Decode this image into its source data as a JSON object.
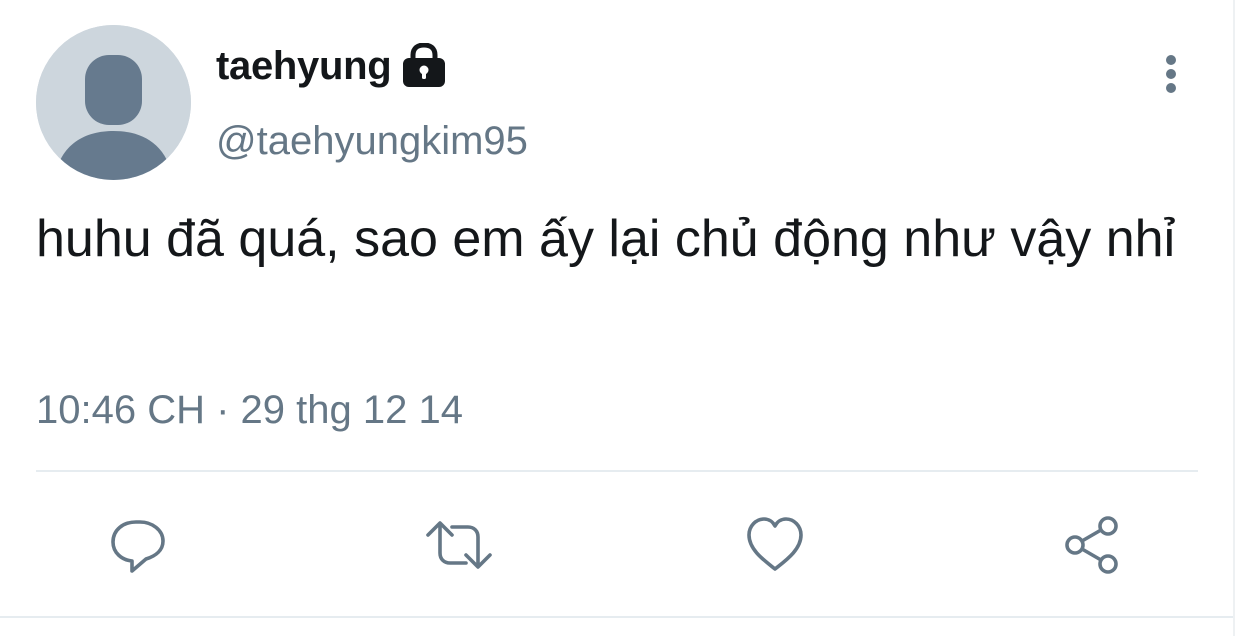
{
  "tweet": {
    "author": {
      "display_name": "taehyung",
      "handle": "@taehyungkim95",
      "protected_icon": "lock-icon",
      "avatar_icon": "default-avatar-icon"
    },
    "text": "huhu đã quá, sao em ấy lại chủ động như vậy nhỉ",
    "timestamp": "10:46 CH · 29 thg 12 14",
    "menu_icon": "more-vertical-icon",
    "actions": [
      {
        "name": "reply",
        "icon": "reply-icon"
      },
      {
        "name": "retweet",
        "icon": "retweet-icon"
      },
      {
        "name": "like",
        "icon": "heart-icon"
      },
      {
        "name": "share",
        "icon": "share-icon"
      }
    ]
  },
  "colors": {
    "text_primary": "#14171a",
    "text_secondary": "#657786",
    "icon": "#657786",
    "divider": "#e6ecf0",
    "avatar_bg": "#cdd6dd",
    "avatar_fg": "#667a8e"
  }
}
